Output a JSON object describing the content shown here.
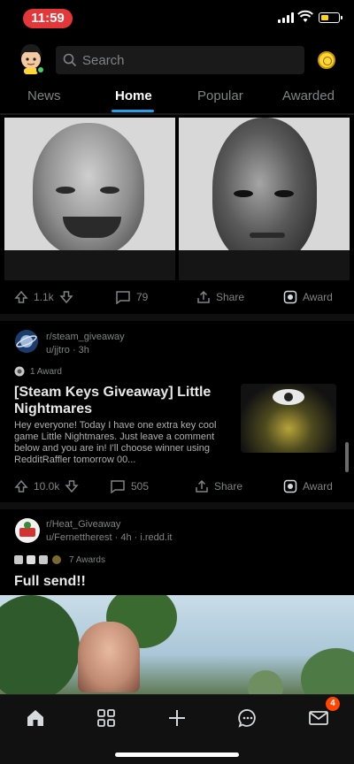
{
  "status_bar": {
    "time": "11:59",
    "time_color": "#e5373a",
    "battery_color": "#ffd60a"
  },
  "header": {
    "search_placeholder": "Search",
    "avatar_icon": "snoo-avatar-icon",
    "coin_icon": "coin-icon",
    "online_status_color": "#46d160"
  },
  "tabs": [
    {
      "label": "News",
      "active": false
    },
    {
      "label": "Home",
      "active": true
    },
    {
      "label": "Popular",
      "active": false
    },
    {
      "label": "Awarded",
      "active": false
    }
  ],
  "accent_color": "#24a0ed",
  "posts": [
    {
      "type": "image",
      "actions": {
        "upvotes": "1.1k",
        "comments": "79",
        "share": "Share",
        "award": "Award"
      }
    },
    {
      "type": "text+thumb",
      "community": "r/steam_giveaway",
      "author": "u/jjtro · 3h",
      "award_count": "1 Award",
      "title": "[Steam Keys Giveaway] Little Nightmares",
      "body": "Hey everyone! Today I have one extra key cool game Little Nightmares. Just leave a comment below and you are in! I'll choose winner using RedditRaffler tomorrow 00...",
      "actions": {
        "upvotes": "10.0k",
        "comments": "505",
        "share": "Share",
        "award": "Award"
      }
    },
    {
      "type": "image",
      "community": "r/Heat_Giveaway",
      "author": "u/Fernettherest · 4h · i.redd.it",
      "award_count": "7 Awards",
      "title": "Full send!!"
    }
  ],
  "bottom_nav": {
    "items": [
      "home-icon",
      "communities-icon",
      "create-post-icon",
      "chat-icon",
      "inbox-icon"
    ],
    "inbox_badge": "4"
  }
}
